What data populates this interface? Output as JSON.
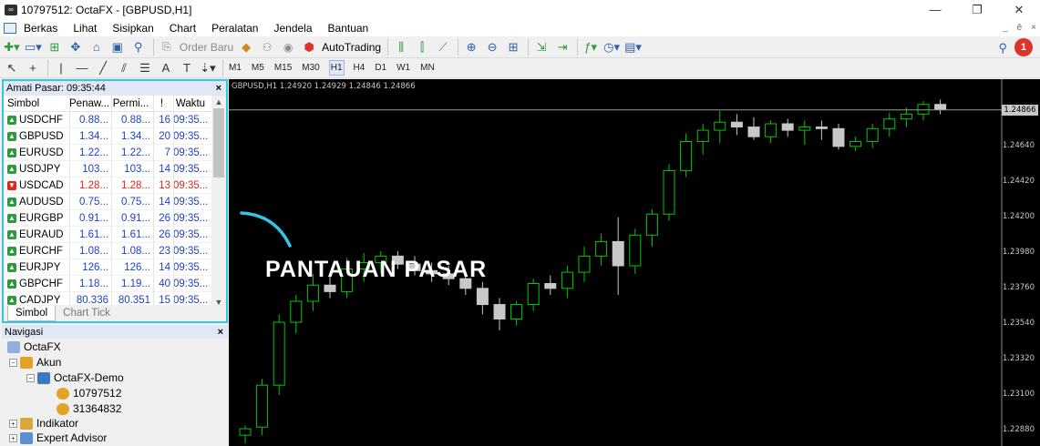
{
  "window": {
    "title": "10797512: OctaFX - [GBPUSD,H1]",
    "minimize": "—",
    "restore": "❐",
    "close": "✕"
  },
  "menu": {
    "items": [
      "Berkas",
      "Lihat",
      "Sisipkan",
      "Chart",
      "Peralatan",
      "Jendela",
      "Bantuan"
    ],
    "mdi": [
      "_",
      "ē",
      "×"
    ]
  },
  "toolbar": {
    "order_label": "Order Baru",
    "autotrading_label": "AutoTrading",
    "notifications": "1"
  },
  "timeframes": {
    "items": [
      "M1",
      "M5",
      "M15",
      "M30",
      "H1",
      "H4",
      "D1",
      "W1",
      "MN"
    ],
    "active": "H1"
  },
  "market_watch": {
    "title": "Amati Pasar: 09:35:44",
    "columns": [
      "Simbol",
      "Penaw...",
      "Permi...",
      "!",
      "Waktu"
    ],
    "rows": [
      {
        "symbol": "USDCHF",
        "bid": "0.88...",
        "ask": "0.88...",
        "spread": "16",
        "time": "09:35...",
        "dir": "up"
      },
      {
        "symbol": "GBPUSD",
        "bid": "1.34...",
        "ask": "1.34...",
        "spread": "20",
        "time": "09:35...",
        "dir": "up"
      },
      {
        "symbol": "EURUSD",
        "bid": "1.22...",
        "ask": "1.22...",
        "spread": "7",
        "time": "09:35...",
        "dir": "up"
      },
      {
        "symbol": "USDJPY",
        "bid": "103...",
        "ask": "103...",
        "spread": "14",
        "time": "09:35...",
        "dir": "up"
      },
      {
        "symbol": "USDCAD",
        "bid": "1.28...",
        "ask": "1.28...",
        "spread": "13",
        "time": "09:35...",
        "dir": "down"
      },
      {
        "symbol": "AUDUSD",
        "bid": "0.75...",
        "ask": "0.75...",
        "spread": "14",
        "time": "09:35...",
        "dir": "up"
      },
      {
        "symbol": "EURGBP",
        "bid": "0.91...",
        "ask": "0.91...",
        "spread": "26",
        "time": "09:35...",
        "dir": "up"
      },
      {
        "symbol": "EURAUD",
        "bid": "1.61...",
        "ask": "1.61...",
        "spread": "26",
        "time": "09:35...",
        "dir": "up"
      },
      {
        "symbol": "EURCHF",
        "bid": "1.08...",
        "ask": "1.08...",
        "spread": "23",
        "time": "09:35...",
        "dir": "up"
      },
      {
        "symbol": "EURJPY",
        "bid": "126...",
        "ask": "126...",
        "spread": "14",
        "time": "09:35...",
        "dir": "up"
      },
      {
        "symbol": "GBPCHF",
        "bid": "1.18...",
        "ask": "1.19...",
        "spread": "40",
        "time": "09:35...",
        "dir": "up"
      },
      {
        "symbol": "CADJPY",
        "bid": "80.336",
        "ask": "80.351",
        "spread": "15",
        "time": "09:35...",
        "dir": "up"
      }
    ],
    "tabs": [
      "Simbol",
      "Chart Tick"
    ],
    "close": "×"
  },
  "navigator": {
    "title": "Navigasi",
    "close": "×",
    "root": "OctaFX",
    "accounts_label": "Akun",
    "server": "OctaFX-Demo",
    "account_ids": [
      "10797512",
      "31364832"
    ],
    "indicators_label": "Indikator",
    "ea_label": "Expert Advisor"
  },
  "chart": {
    "title": "GBPUSD,H1  1.24920 1.24929 1.24846 1.24866",
    "current_price": "1.24866",
    "price_labels": [
      "1.24640",
      "1.24420",
      "1.24200",
      "1.23980",
      "1.23760",
      "1.23540",
      "1.23320",
      "1.23100",
      "1.22880"
    ],
    "bull_color": "#00c800",
    "bear_color": "#c8c8c8"
  },
  "annotation": {
    "text": "PANTAUAN PASAR",
    "color": "#31c6e8"
  },
  "chart_data": {
    "type": "candlestick",
    "title": "GBPUSD,H1",
    "ylim": [
      1.228,
      1.25
    ],
    "ohlc": [
      [
        1.2285,
        1.2291,
        1.228,
        1.2289
      ],
      [
        1.229,
        1.232,
        1.2285,
        1.2316
      ],
      [
        1.2316,
        1.236,
        1.231,
        1.2355
      ],
      [
        1.2355,
        1.2372,
        1.2348,
        1.2368
      ],
      [
        1.2368,
        1.2385,
        1.2362,
        1.2378
      ],
      [
        1.2378,
        1.2386,
        1.237,
        1.2374
      ],
      [
        1.2374,
        1.2395,
        1.237,
        1.2388
      ],
      [
        1.2388,
        1.2398,
        1.238,
        1.2392
      ],
      [
        1.2392,
        1.2399,
        1.2385,
        1.2396
      ],
      [
        1.2396,
        1.2399,
        1.2388,
        1.2391
      ],
      [
        1.2391,
        1.2396,
        1.2384,
        1.2387
      ],
      [
        1.2387,
        1.2392,
        1.238,
        1.2385
      ],
      [
        1.2385,
        1.239,
        1.2378,
        1.2382
      ],
      [
        1.2382,
        1.2386,
        1.2372,
        1.2376
      ],
      [
        1.2376,
        1.238,
        1.236,
        1.2366
      ],
      [
        1.2366,
        1.237,
        1.235,
        1.2357
      ],
      [
        1.2357,
        1.2368,
        1.2353,
        1.2366
      ],
      [
        1.2366,
        1.2382,
        1.2362,
        1.2379
      ],
      [
        1.2379,
        1.2384,
        1.2372,
        1.2376
      ],
      [
        1.2376,
        1.239,
        1.237,
        1.2386
      ],
      [
        1.2386,
        1.2402,
        1.238,
        1.2396
      ],
      [
        1.2396,
        1.241,
        1.239,
        1.2405
      ],
      [
        1.2405,
        1.242,
        1.2372,
        1.239
      ],
      [
        1.239,
        1.2413,
        1.2385,
        1.2409
      ],
      [
        1.2409,
        1.2425,
        1.2402,
        1.2422
      ],
      [
        1.2422,
        1.2453,
        1.2418,
        1.2449
      ],
      [
        1.2449,
        1.2472,
        1.2445,
        1.2467
      ],
      [
        1.2467,
        1.2478,
        1.2459,
        1.2474
      ],
      [
        1.2474,
        1.2486,
        1.2466,
        1.2479
      ],
      [
        1.2479,
        1.2484,
        1.2471,
        1.2476
      ],
      [
        1.2476,
        1.2482,
        1.2468,
        1.247
      ],
      [
        1.247,
        1.248,
        1.2466,
        1.2478
      ],
      [
        1.2478,
        1.2481,
        1.247,
        1.2474
      ],
      [
        1.2474,
        1.248,
        1.2465,
        1.2476
      ],
      [
        1.2476,
        1.248,
        1.2468,
        1.2475
      ],
      [
        1.2475,
        1.2478,
        1.2462,
        1.2464
      ],
      [
        1.2464,
        1.247,
        1.2461,
        1.2467
      ],
      [
        1.2467,
        1.2478,
        1.2463,
        1.2475
      ],
      [
        1.2475,
        1.2485,
        1.247,
        1.2481
      ],
      [
        1.2481,
        1.2488,
        1.2476,
        1.2484
      ],
      [
        1.2484,
        1.2492,
        1.248,
        1.249
      ],
      [
        1.249,
        1.2493,
        1.2484,
        1.2487
      ]
    ]
  }
}
